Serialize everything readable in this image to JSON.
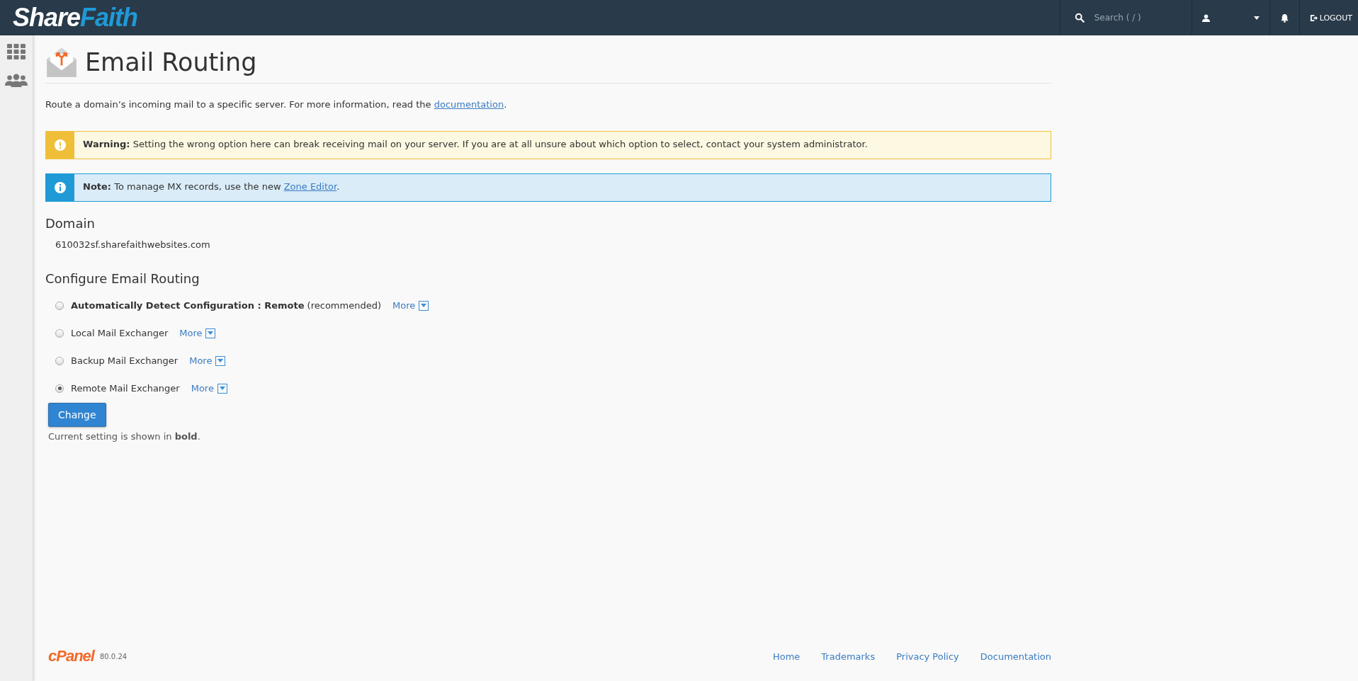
{
  "header": {
    "logo_parts": [
      "Share",
      "Faith"
    ],
    "search": {
      "placeholder": "Search ( / )"
    },
    "logout": "LOGOUT"
  },
  "page": {
    "title": "Email Routing",
    "intro": "Route a domain’s incoming mail to a specific server. For more information, read the ",
    "intro_link": "documentation",
    "intro_end": "."
  },
  "alerts": [
    {
      "kind": "warning",
      "label": "Warning:",
      "text": "Setting the wrong option here can break receiving mail on your server. If you are at all unsure about which option to select, contact your system administrator."
    },
    {
      "kind": "info",
      "label": "Note:",
      "text": "To manage MX records, use the new ",
      "link": "Zone Editor",
      "end": "."
    }
  ],
  "domain": {
    "heading": "Domain",
    "value": "610032sf.sharefaithwebsites.com"
  },
  "routing": {
    "heading": "Configure Email Routing",
    "options": [
      {
        "label": "**Automatically Detect Configuration : Remote** (recommended)",
        "more": "More",
        "selected": false
      },
      {
        "label": "Local Mail Exchanger",
        "more": "More",
        "selected": false
      },
      {
        "label": "Backup Mail Exchanger",
        "more": "More",
        "selected": false
      },
      {
        "label": "Remote Mail Exchanger",
        "more": "More",
        "selected": true
      }
    ],
    "button": "Change",
    "note": "Current setting is shown in **bold**."
  },
  "footer": {
    "logo": "cPanel",
    "version": "80.0.24",
    "links": [
      "Home",
      "Trademarks",
      "Privacy Policy",
      "Documentation"
    ]
  }
}
